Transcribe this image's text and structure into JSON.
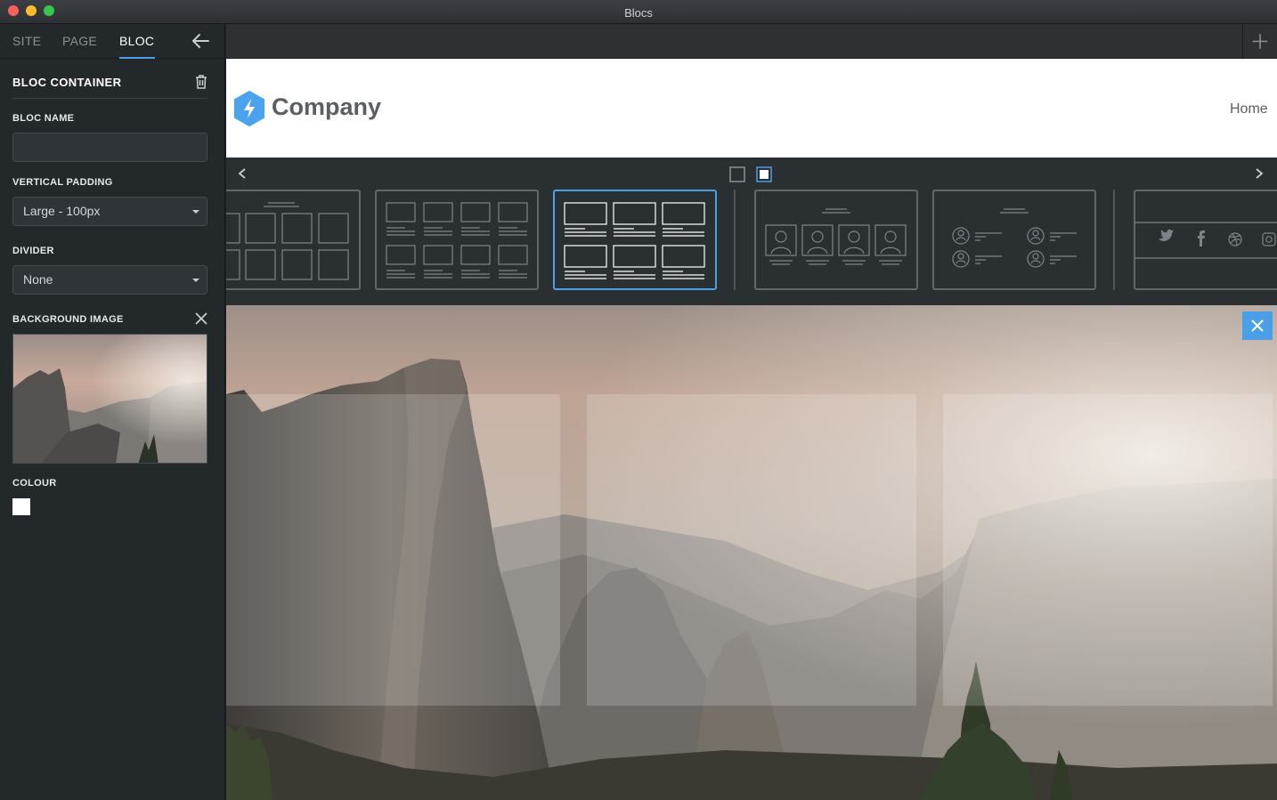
{
  "window": {
    "title": "Blocs"
  },
  "sidebar": {
    "tabs": [
      {
        "label": "SITE"
      },
      {
        "label": "PAGE"
      },
      {
        "label": "BLOC"
      }
    ],
    "active_tab": "BLOC",
    "section_title": "BLOC CONTAINER",
    "bloc_name": {
      "label": "BLOC NAME",
      "value": "",
      "placeholder": ""
    },
    "vertical_padding": {
      "label": "VERTICAL PADDING",
      "value": "Large - 100px"
    },
    "divider": {
      "label": "DIVIDER",
      "value": "None"
    },
    "background_image": {
      "label": "BACKGROUND IMAGE"
    },
    "colour": {
      "label": "COLOUR",
      "value": "#ffffff"
    }
  },
  "header": {
    "logo_text": "Company",
    "nav": {
      "home": "Home"
    }
  },
  "colors": {
    "accent": "#4a9fe8",
    "sidebar_bg": "#23282b",
    "panel_bg": "#2a2f32"
  },
  "icons": [
    "trash-icon",
    "back-arrow-icon",
    "close-icon",
    "plus-icon",
    "chevron-left-icon",
    "chevron-right-icon",
    "bolt-logo-icon",
    "twitter-icon",
    "facebook-icon",
    "dribbble-icon",
    "instagram-icon"
  ]
}
